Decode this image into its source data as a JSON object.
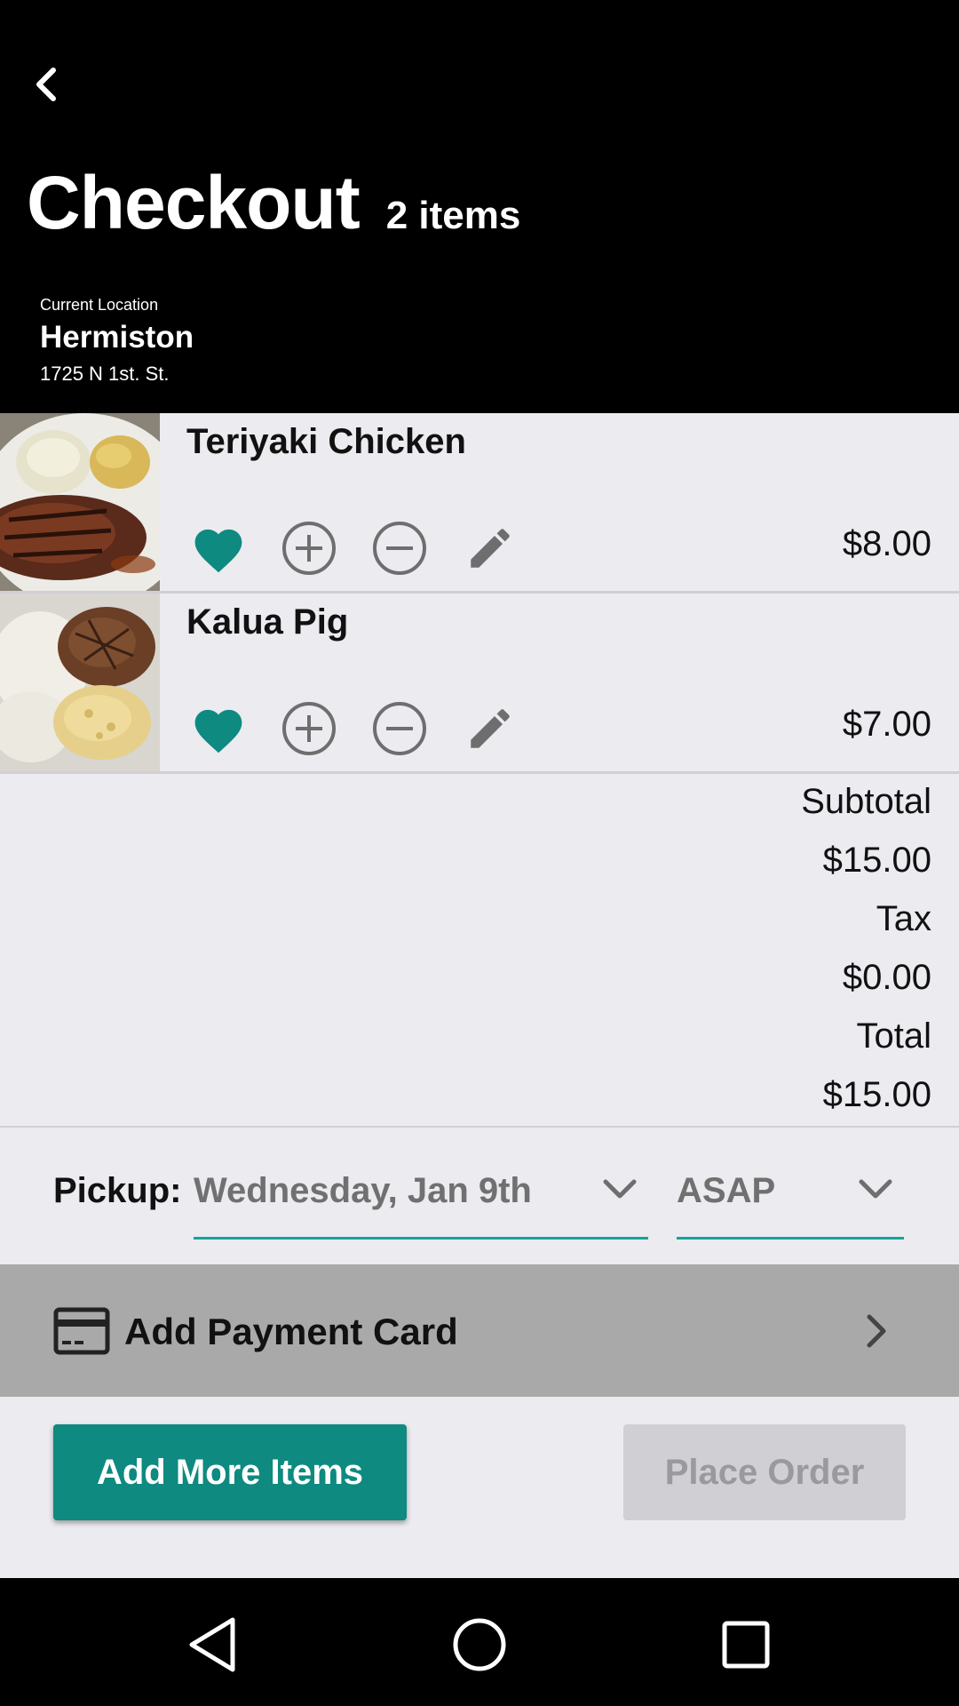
{
  "header": {
    "title": "Checkout",
    "item_count": "2 items",
    "location_label": "Current Location",
    "location_name": "Hermiston",
    "location_address": "1725 N 1st. St."
  },
  "cart": {
    "items": [
      {
        "name": "Teriyaki Chicken",
        "price": "$8.00",
        "favorited": true
      },
      {
        "name": "Kalua Pig",
        "price": "$7.00",
        "favorited": true
      }
    ]
  },
  "totals": {
    "subtotal_label": "Subtotal",
    "subtotal_value": "$15.00",
    "tax_label": "Tax",
    "tax_value": "$0.00",
    "total_label": "Total",
    "total_value": "$15.00"
  },
  "pickup": {
    "label": "Pickup:",
    "date": "Wednesday, Jan 9th",
    "time": "ASAP"
  },
  "payment": {
    "label": "Add Payment Card"
  },
  "buttons": {
    "add_more": "Add More Items",
    "place_order": "Place Order"
  },
  "colors": {
    "accent": "#0e8a80",
    "underline": "#13a597",
    "icon_gray": "#6e6e6e",
    "payment_bar": "#a9a9a9"
  },
  "icons": {
    "back": "chevron-left-icon",
    "favorite": "heart-icon",
    "increase": "plus-circle-icon",
    "decrease": "minus-circle-icon",
    "edit": "pencil-icon",
    "dropdown": "chevron-down-icon",
    "card": "credit-card-icon",
    "forward": "chevron-right-icon"
  }
}
